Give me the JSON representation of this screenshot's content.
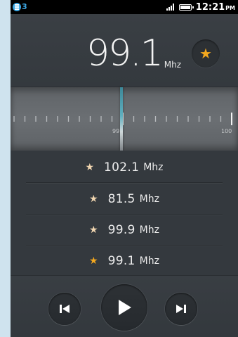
{
  "status_bar": {
    "notification_count": "3",
    "time": "12:21",
    "ampm": "PM",
    "accent_color": "#3da9e6"
  },
  "tuner": {
    "frequency": "99.1",
    "unit": "Mhz",
    "favorite_icon": "star-icon",
    "star_color": "#f4a81e",
    "dial_labels": [
      "99",
      "100"
    ]
  },
  "favorites": [
    {
      "frequency": "102.1",
      "unit": "Mhz",
      "active": false
    },
    {
      "frequency": "81.5",
      "unit": "Mhz",
      "active": false
    },
    {
      "frequency": "99.9",
      "unit": "Mhz",
      "active": false
    },
    {
      "frequency": "99.1",
      "unit": "Mhz",
      "active": true
    }
  ],
  "controls": {
    "prev_icon": "skip-previous-icon",
    "play_icon": "play-icon",
    "next_icon": "skip-next-icon"
  }
}
